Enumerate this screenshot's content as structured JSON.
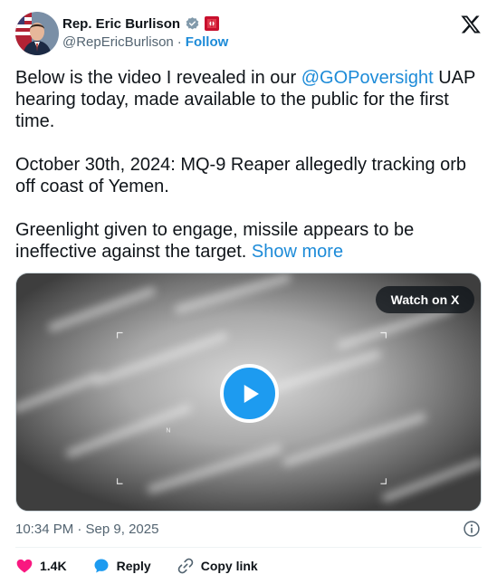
{
  "author": {
    "display_name": "Rep. Eric Burlison",
    "handle": "@RepEricBurlison",
    "separator": "·",
    "follow_label": "Follow"
  },
  "tweet": {
    "p1_text_a": "Below is the video I revealed in our ",
    "p1_mention": "@GOPoversight",
    "p1_text_b": " UAP hearing today, made available to the public for the first time.",
    "p2_text": "October 30th, 2024: MQ-9 Reaper allegedly tracking orb off coast of Yemen.",
    "p3_text": "Greenlight given to engage, missile appears to be ineffective against the target. ",
    "show_more": "Show more"
  },
  "media": {
    "watch_label": "Watch on X"
  },
  "meta": {
    "timestamp": "10:34 PM · Sep 9, 2025"
  },
  "actions": {
    "likes_count": "1.4K",
    "reply_label": "Reply",
    "copy_link_label": "Copy link"
  },
  "colors": {
    "accent": "#1d9bf0",
    "link": "#1d8bd8",
    "like": "#f91880",
    "muted": "#536471",
    "text": "#0f1419"
  },
  "icons": [
    "verified-icon",
    "flag-icon",
    "x-logo-icon",
    "play-icon",
    "info-icon",
    "heart-icon",
    "reply-icon",
    "link-icon"
  ]
}
